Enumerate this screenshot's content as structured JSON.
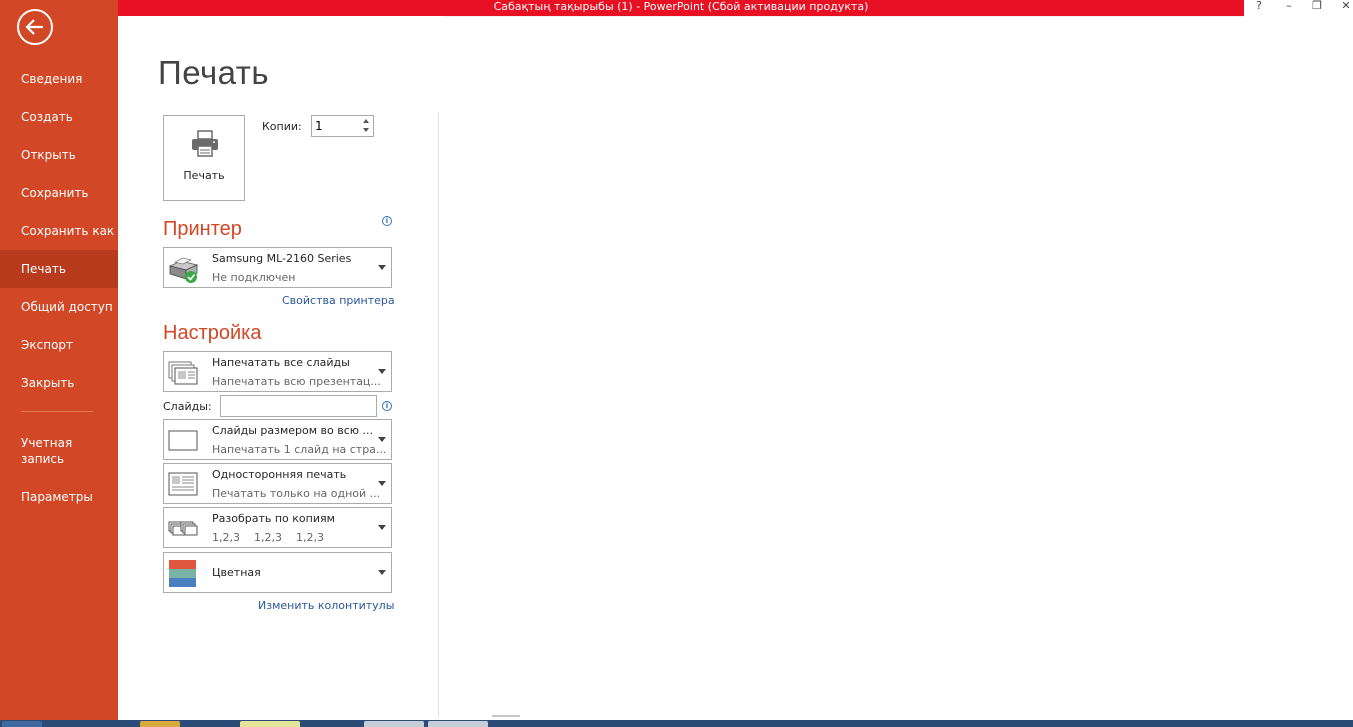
{
  "window": {
    "title": "Сабақтың тақырыбы (1) -  PowerPoint (Сбой активации продукта)",
    "help": "?",
    "minimize": "–",
    "restore": "❐",
    "close": "✕"
  },
  "nav": {
    "items": [
      {
        "label": "Сведения"
      },
      {
        "label": "Создать"
      },
      {
        "label": "Открыть"
      },
      {
        "label": "Сохранить"
      },
      {
        "label": "Сохранить как"
      },
      {
        "label": "Печать"
      },
      {
        "label": "Общий доступ"
      },
      {
        "label": "Экспорт"
      },
      {
        "label": "Закрыть"
      },
      {
        "label": "Учетная запись"
      },
      {
        "label": "Параметры"
      }
    ],
    "active": "Печать"
  },
  "page": {
    "title": "Печать"
  },
  "print_button": {
    "label": "Печать"
  },
  "copies": {
    "label": "Копии:",
    "value": "1"
  },
  "printer": {
    "heading": "Принтер",
    "name": "Samsung ML-2160 Series",
    "status": "Не подключен",
    "properties_link": "Свойства принтера"
  },
  "settings": {
    "heading": "Настройка",
    "range": {
      "title": "Напечатать все слайды",
      "sub": "Напечатать всю презентац..."
    },
    "slides_label": "Слайды:",
    "slides_value": "",
    "layout": {
      "title": "Слайды размером во всю ...",
      "sub": "Напечатать 1 слайд на стра..."
    },
    "sides": {
      "title": "Односторонняя печать",
      "sub": "Печатать только на одной ..."
    },
    "collate": {
      "title": "Разобрать по копиям",
      "sub": "1,2,3    1,2,3    1,2,3"
    },
    "color": {
      "title": "Цветная"
    },
    "headers_link": "Изменить колонтитулы"
  },
  "colors": {
    "accent": "#d24726",
    "titlebar": "#e81123",
    "link": "#2b579a"
  }
}
